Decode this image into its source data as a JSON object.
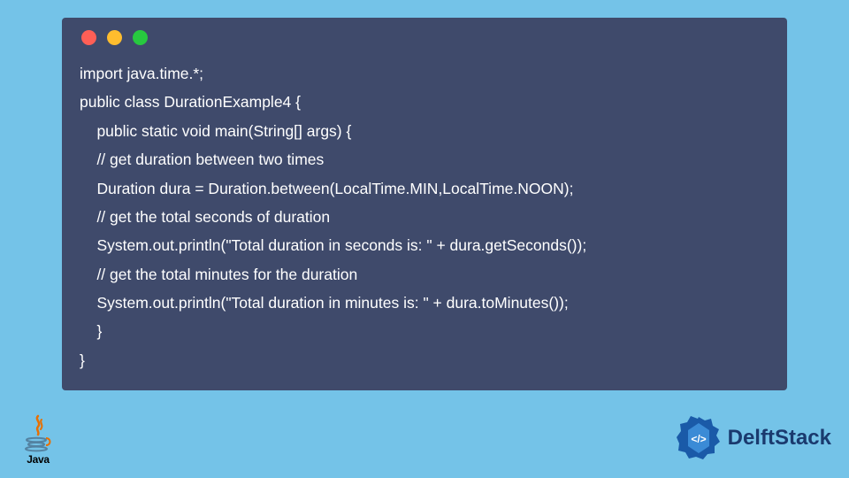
{
  "code": {
    "lines": [
      "import java.time.*;",
      "public class DurationExample4 {",
      "    public static void main(String[] args) {",
      "    // get duration between two times",
      "    Duration dura = Duration.between(LocalTime.MIN,LocalTime.NOON);",
      "    // get the total seconds of duration",
      "    System.out.println(\"Total duration in seconds is: \" + dura.getSeconds());",
      "    // get the total minutes for the duration",
      "    System.out.println(\"Total duration in minutes is: \" + dura.toMinutes());",
      "    }",
      "}"
    ]
  },
  "window": {
    "dot_colors": {
      "close": "#ff5f56",
      "minimize": "#ffbd2e",
      "zoom": "#27c93f"
    }
  },
  "logos": {
    "java_label": "Java",
    "delft_label": "DelftStack"
  },
  "colors": {
    "page_bg": "#74c3e8",
    "window_bg": "#3f4a6b",
    "code_text": "#ffffff",
    "delft_accent": "#1a3a6e"
  }
}
